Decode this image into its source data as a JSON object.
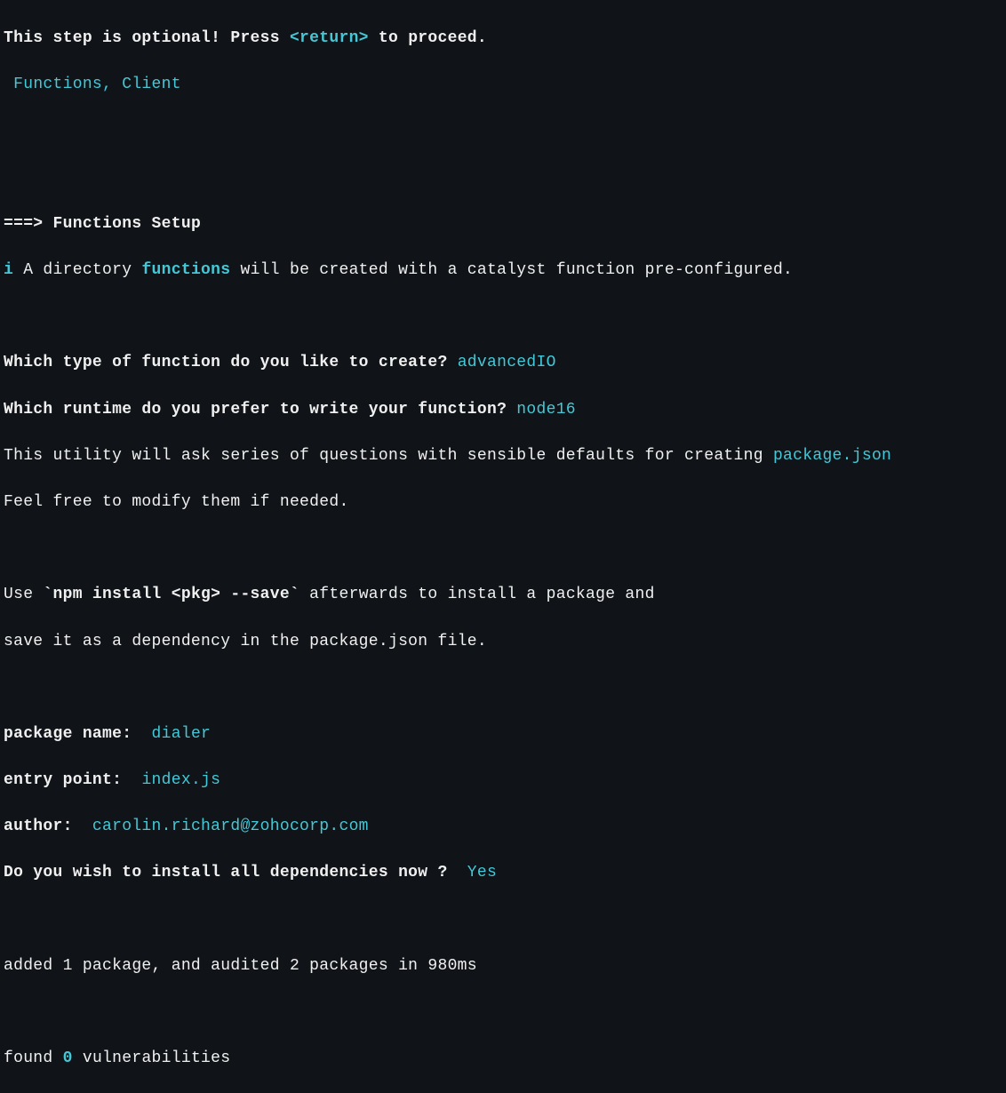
{
  "line1": {
    "prefix": "This step is optional! Press ",
    "key": "<return>",
    "suffix": " to proceed."
  },
  "line2": " Functions, Client",
  "line3": {
    "arrow": "===> ",
    "title": "Functions Setup"
  },
  "line4": {
    "icon": "i",
    "prefix": " A directory ",
    "dir": "functions",
    "suffix": " will be created with a catalyst function pre-configured."
  },
  "line5": {
    "q": "Which type of function do you like to create? ",
    "a": "advancedIO"
  },
  "line6": {
    "q": "Which runtime do you prefer to write your function? ",
    "a": "node16"
  },
  "line7": {
    "prefix": "This utility will ask series of questions with sensible defaults for creating ",
    "file": "package.json"
  },
  "line8": "Feel free to modify them if needed.",
  "line9": {
    "a": "Use ",
    "cmd": "`npm install <pkg> --save`",
    "b": " afterwards to install a package and"
  },
  "line10": "save it as a dependency in the package.json file.",
  "line11": {
    "label": "package name:  ",
    "val": "dialer"
  },
  "line12": {
    "label": "entry point:  ",
    "val": "index.js"
  },
  "line13": {
    "label": "author:  ",
    "val": "carolin.richard@zohocorp.com"
  },
  "line14": {
    "q": "Do you wish to install all dependencies now ?  ",
    "a": "Yes"
  },
  "line15": "added 1 package, and audited 2 packages in 980ms",
  "line16": {
    "a": "found ",
    "n": "0",
    "b": " vulnerabilities"
  }
}
